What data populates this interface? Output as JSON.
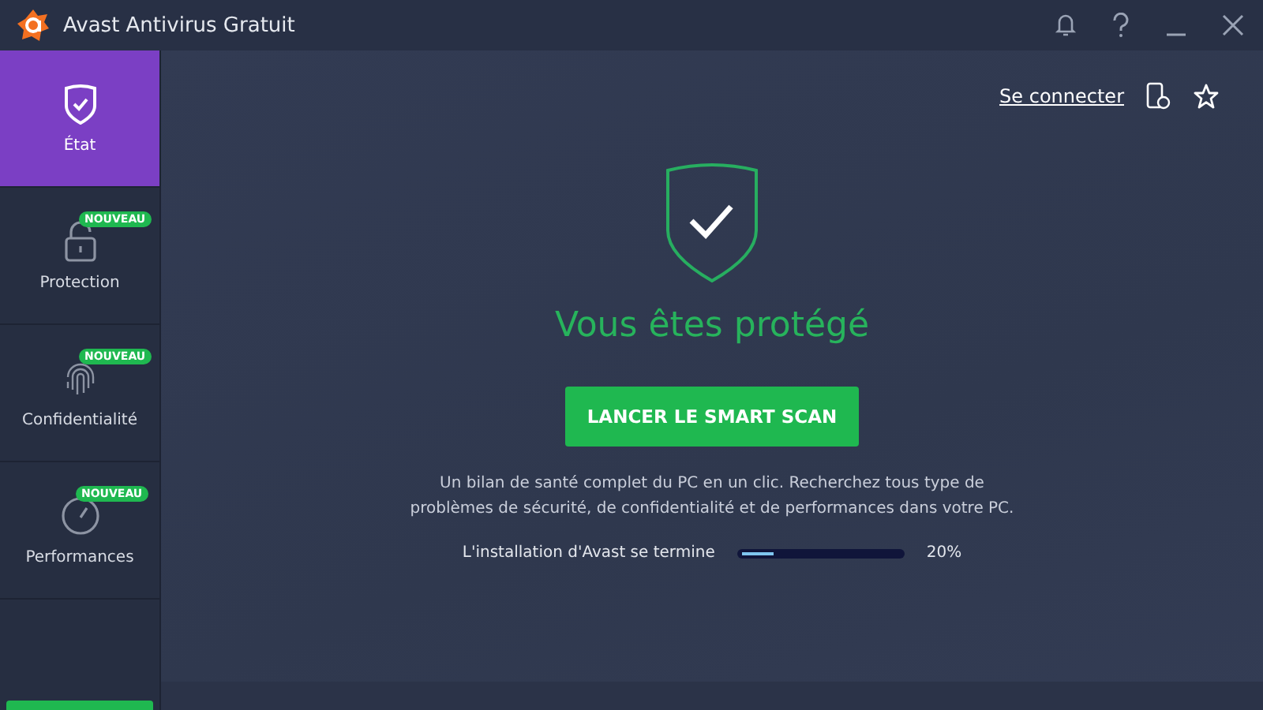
{
  "window": {
    "title": "Avast Antivirus Gratuit"
  },
  "sidebar": {
    "items": [
      {
        "label": "État",
        "kind": "shield",
        "selected": true
      },
      {
        "label": "Protection",
        "kind": "lock",
        "selected": false,
        "badge": "NOUVEAU"
      },
      {
        "label": "Confidentialité",
        "kind": "fingerprint",
        "selected": false,
        "badge": "NOUVEAU"
      },
      {
        "label": "Performances",
        "kind": "gauge",
        "selected": false,
        "badge": "NOUVEAU"
      }
    ]
  },
  "header": {
    "link": "Se connecter"
  },
  "status": {
    "title": "Vous êtes protégé",
    "button": "LANCER LE SMART SCAN",
    "description": "Un bilan de santé complet du PC en un clic. Recherchez tous type de problèmes de sécurité, de confidentialité et de performances dans votre PC."
  },
  "install": {
    "label": "L'installation d'Avast se termine",
    "level": 0.2,
    "reading": "20%"
  }
}
